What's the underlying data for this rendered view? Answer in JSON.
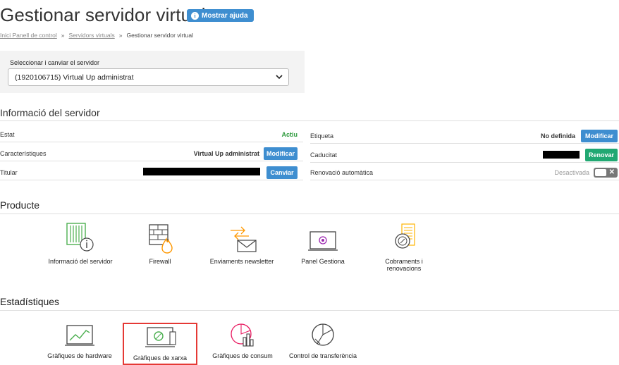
{
  "header": {
    "title": "Gestionar servidor virtual",
    "help_label": "Mostrar ajuda"
  },
  "breadcrumb": {
    "home": "Inici Panell de control",
    "sep": "»",
    "servers": "Servidors virtuals",
    "current": "Gestionar servidor virtual"
  },
  "server_selector": {
    "label": "Seleccionar i canviar el servidor",
    "value": "(1920106715) Virtual Up administrat"
  },
  "server_info": {
    "title": "Informació del servidor",
    "estat_label": "Estat",
    "estat_value": "Actiu",
    "caract_label": "Característiques",
    "caract_value": "Virtual Up administrat",
    "caract_button": "Modificar",
    "titular_label": "Titular",
    "titular_button": "Canviar",
    "etiqueta_label": "Etiqueta",
    "etiqueta_value": "No definida",
    "etiqueta_button": "Modificar",
    "caducitat_label": "Caducitat",
    "caducitat_button": "Renovar",
    "renovacio_label": "Renovació automàtica",
    "renovacio_value": "Desactivada"
  },
  "product": {
    "title": "Producte",
    "items": [
      {
        "label": "Informació del servidor",
        "icon": "server-info-icon"
      },
      {
        "label": "Firewall",
        "icon": "firewall-icon"
      },
      {
        "label": "Enviaments newsletter",
        "icon": "newsletter-icon"
      },
      {
        "label": "Panel Gestiona",
        "icon": "panel-icon"
      },
      {
        "label": "Cobraments i renovacions",
        "icon": "billing-icon"
      }
    ]
  },
  "stats": {
    "title": "Estadístiques",
    "items": [
      {
        "label": "Gràfiques de hardware",
        "icon": "hardware-chart-icon"
      },
      {
        "label": "Gràfiques de xarxa",
        "icon": "network-chart-icon"
      },
      {
        "label": "Gràfiques de consum",
        "icon": "consumption-chart-icon"
      },
      {
        "label": "Control de transferència",
        "icon": "transfer-control-icon"
      }
    ]
  },
  "colors": {
    "accent_blue": "#3e8ed0",
    "green": "#21a872",
    "selection_red": "#e53935"
  }
}
